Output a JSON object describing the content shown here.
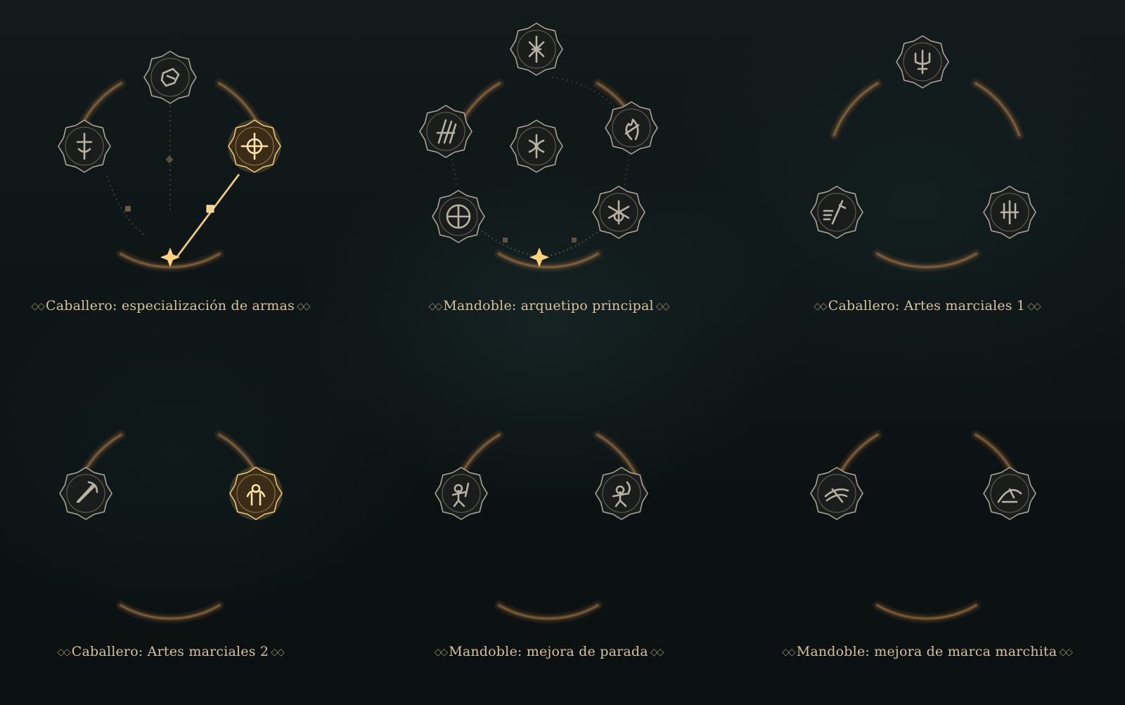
{
  "colors": {
    "gold_glow": "#f5c46a",
    "title_text": "#d9c29a",
    "node_ring": "#bdb6a8",
    "arc": "#c7894a"
  },
  "panels": [
    {
      "title": "Caballero: especialización de armas",
      "nodes": [
        {
          "icon": "gauntlet-icon",
          "active": false
        },
        {
          "icon": "rune-sword-icon",
          "active": false
        },
        {
          "icon": "crosshair-sigil-icon",
          "active": true
        }
      ]
    },
    {
      "title": "Mandoble: arquetipo principal",
      "nodes": [
        {
          "icon": "spiked-sigil-icon",
          "active": false
        },
        {
          "icon": "claw-sigil-icon",
          "active": false
        },
        {
          "icon": "rune-knot-icon",
          "active": false
        },
        {
          "icon": "flame-sigil-icon",
          "active": false
        },
        {
          "icon": "circle-rune-icon",
          "active": false
        },
        {
          "icon": "star-rune-icon",
          "active": false
        }
      ]
    },
    {
      "title": "Caballero: Artes marciales 1",
      "nodes": [
        {
          "icon": "trident-rune-icon",
          "active": false
        },
        {
          "icon": "sword-dash-icon",
          "active": false
        },
        {
          "icon": "fork-rune-icon",
          "active": false
        }
      ]
    },
    {
      "title": "Caballero: Artes marciales 2",
      "nodes": [
        {
          "icon": "crossed-axes-icon",
          "active": false
        },
        {
          "icon": "flexing-warrior-icon",
          "active": true
        }
      ]
    },
    {
      "title": "Mandoble: mejora de parada",
      "nodes": [
        {
          "icon": "warrior-parry-icon",
          "active": false
        },
        {
          "icon": "burning-warrior-icon",
          "active": false
        }
      ]
    },
    {
      "title": "Mandoble: mejora de marca marchita",
      "nodes": [
        {
          "icon": "wind-slash-icon",
          "active": false
        },
        {
          "icon": "sweeping-strike-icon",
          "active": false
        }
      ]
    }
  ]
}
